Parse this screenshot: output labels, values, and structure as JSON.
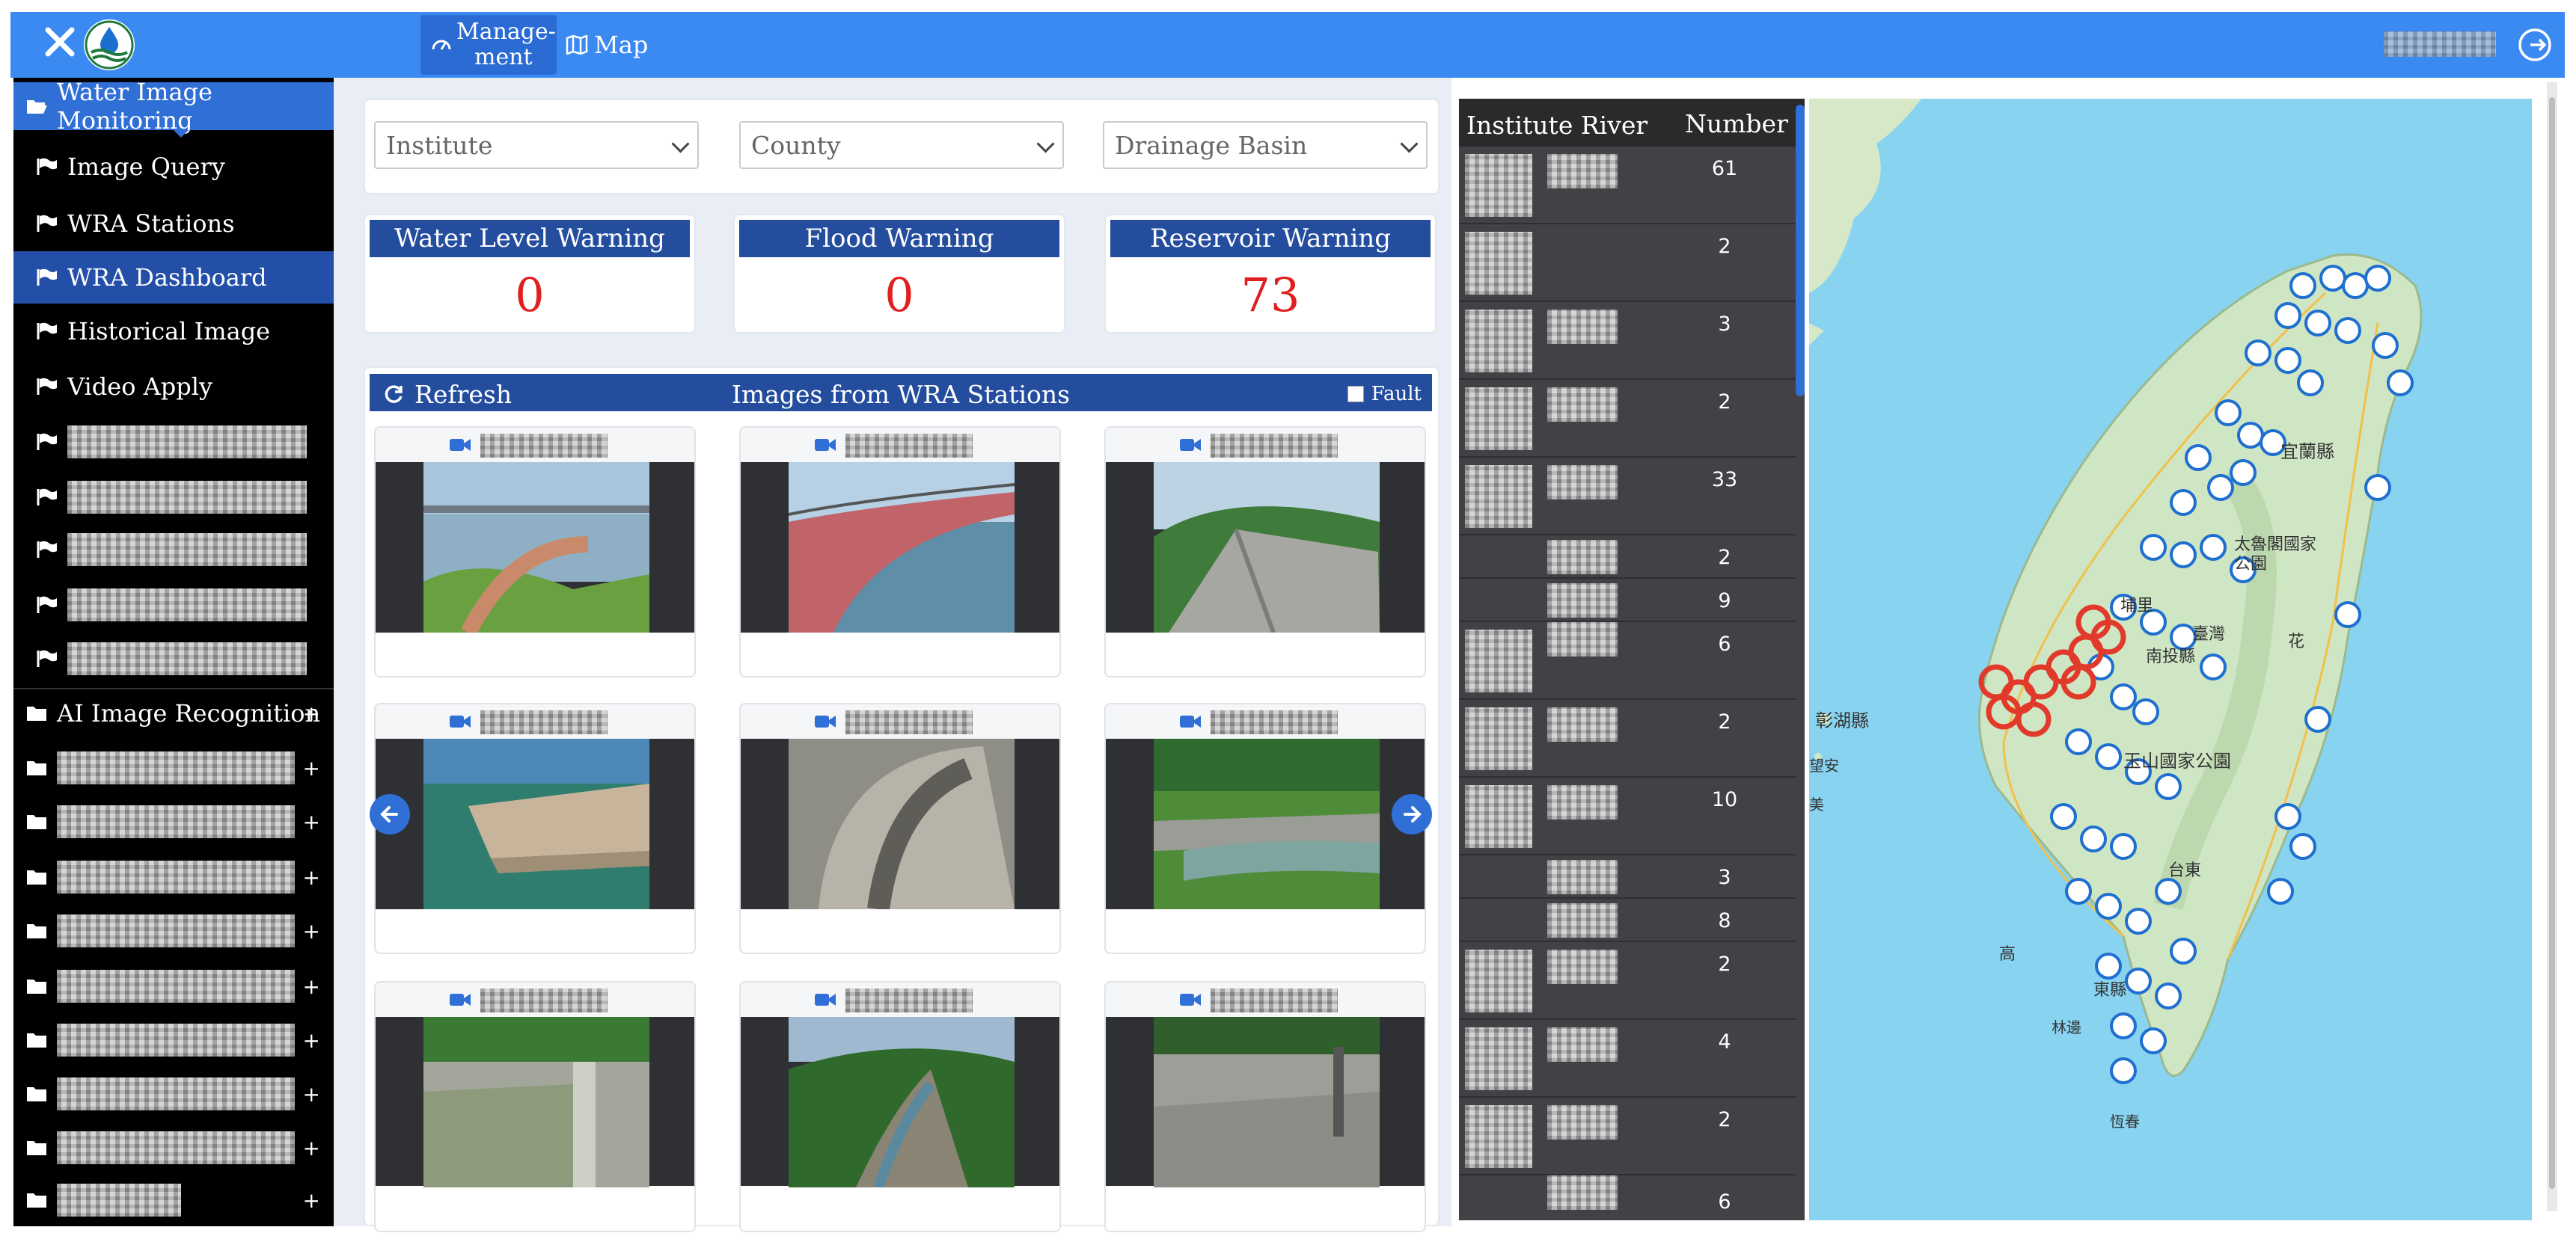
{
  "topbar": {
    "nav": [
      {
        "label_line1": "Manage-",
        "label_line2": "ment"
      },
      {
        "label": "Map"
      }
    ]
  },
  "sidebar": {
    "section_title": "Water Image Monitoring",
    "items": [
      {
        "label": "Image Query"
      },
      {
        "label": "WRA Stations"
      },
      {
        "label": "WRA Dashboard"
      },
      {
        "label": "Historical Image"
      },
      {
        "label": "Video Apply"
      }
    ],
    "groups": [
      {
        "label": "AI Image Recognition",
        "expander": "+"
      }
    ]
  },
  "filters": {
    "institute": "Institute",
    "county": "County",
    "drainage_basin": "Drainage Basin"
  },
  "warnings": [
    {
      "label": "Water Level Warning",
      "value": "0"
    },
    {
      "label": "Flood Warning",
      "value": "0"
    },
    {
      "label": "Reservoir Warning",
      "value": "73"
    }
  ],
  "images_panel": {
    "refresh_label": "Refresh",
    "title": "Images from WRA Stations",
    "fault_label": "Fault"
  },
  "table": {
    "col_river": "Institute River",
    "col_number": "Number",
    "numbers": [
      "61",
      "2",
      "3",
      "2",
      "33",
      "2",
      "9",
      "6",
      "2",
      "10",
      "3",
      "8",
      "2",
      "4",
      "2",
      "6"
    ]
  },
  "colors": {
    "topbar": "#3b8af2",
    "panel_header": "#254d9e",
    "warning_value": "#e02020",
    "sidebar_bg": "#000000",
    "sidebar_active": "#2f6fd6"
  },
  "map": {
    "labels": [
      "宜蘭縣",
      "太魯閣國家公園",
      "埔里",
      "臺灣",
      "南投縣",
      "花",
      "彰湖縣",
      "望安",
      "美",
      "玉山國家公園",
      "台東",
      "高",
      "東縣",
      "林邊",
      "恆春"
    ]
  }
}
